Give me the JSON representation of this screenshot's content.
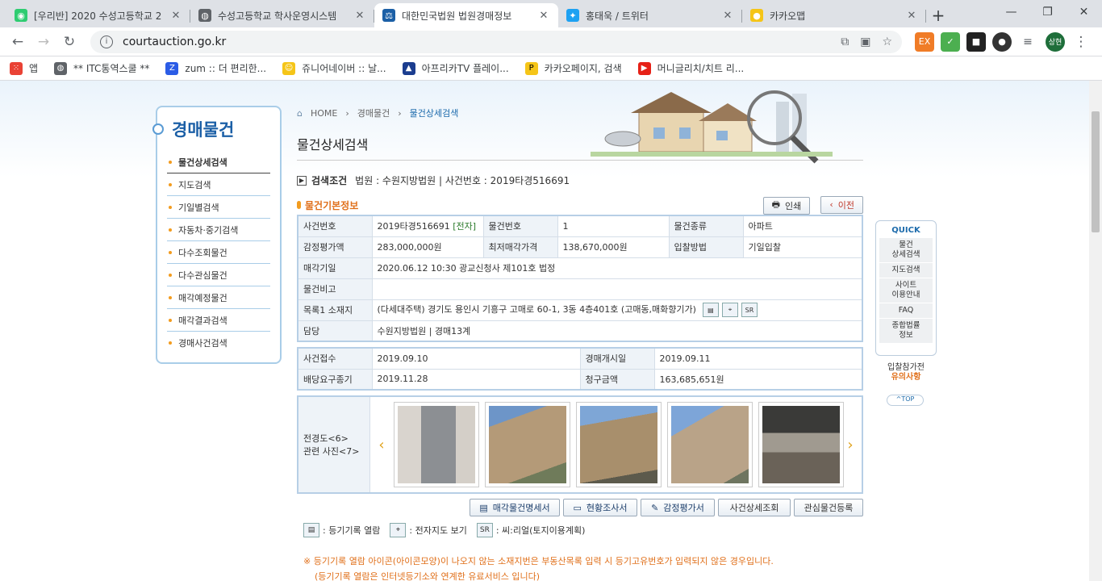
{
  "browser": {
    "tabs": [
      {
        "title": "[우리반] 2020 수성고등학교 2",
        "color": "#2ecc71"
      },
      {
        "title": "수성고등학교 학사운영시스템",
        "color": "#5f6368"
      },
      {
        "title": "대한민국법원 법원경매정보",
        "color": "#1b5fa6"
      },
      {
        "title": "홍태욱 / 트위터",
        "color": "#1da1f2"
      },
      {
        "title": "카카오맵",
        "color": "#f5c518"
      }
    ],
    "url": "courtauction.go.kr",
    "avatar": "상현",
    "bookmarks": [
      {
        "label": "앱",
        "color": "#e94235"
      },
      {
        "label": "** ITC통역스쿨 **",
        "color": "#5f6368"
      },
      {
        "label": "zum :: 더 편리한...",
        "color": "#2b5ce6"
      },
      {
        "label": "쥬니어네이버 :: 날...",
        "color": "#f5c518"
      },
      {
        "label": "아프리카TV 플레이...",
        "color": "#1b3d8f"
      },
      {
        "label": "카카오페이지, 검색",
        "color": "#f5c518"
      },
      {
        "label": "머니글리치/치트 리...",
        "color": "#e62117"
      }
    ]
  },
  "left_nav": {
    "title": "경매물건",
    "items": [
      "물건상세검색",
      "지도검색",
      "기일별검색",
      "자동차·중기검색",
      "다수조회물건",
      "다수관심물건",
      "매각예정물건",
      "매각결과검색",
      "경매사건검색"
    ]
  },
  "breadcrumb": {
    "home": "HOME",
    "level1": "경매물건",
    "level2": "물건상세검색"
  },
  "page_title": "물건상세검색",
  "search_condition": {
    "label": "검색조건",
    "value": "법원 : 수원지방법원 | 사건번호 : 2019타경516691"
  },
  "section_title": "물건기본정보",
  "buttons": {
    "print": "인쇄",
    "prev": "이전"
  },
  "basic_info": {
    "case_no_label": "사건번호",
    "case_no": "2019타경516691",
    "case_tag": "[전자]",
    "item_no_label": "물건번호",
    "item_no": "1",
    "item_type_label": "물건종류",
    "item_type": "아파트",
    "appraisal_label": "감정평가액",
    "appraisal": "283,000,000원",
    "min_price_label": "최저매각가격",
    "min_price": "138,670,000원",
    "bid_method_label": "입찰방법",
    "bid_method": "기일입찰",
    "sale_date_label": "매각기일",
    "sale_date": "2020.06.12 10:30 광교신청사 제101호 법정",
    "remarks_label": "물건비고",
    "remarks": "",
    "address_label": "목록1 소재지",
    "address": "(다세대주택) 경기도 용인시 기흥구 고매로 60-1, 3동 4층401호 (고매동,매화향기가)",
    "dept_label": "담당",
    "dept": "수원지방법원 | 경매13계"
  },
  "case_info": {
    "received_label": "사건접수",
    "received": "2019.09.10",
    "start_label": "경매개시일",
    "start": "2019.09.11",
    "dividend_label": "배당요구종기",
    "dividend": "2019.11.28",
    "claim_label": "청구금액",
    "claim": "163,685,651원"
  },
  "photos": {
    "label_line1": "전경도<6>",
    "label_line2": "관련 사진<7>"
  },
  "doc_buttons": [
    "매각물건명세서",
    "현황조사서",
    "감정평가서",
    "사건상세조회",
    "관심물건등록"
  ],
  "legend": [
    {
      "icon": "registry-icon",
      "text": ": 등기기록 열람"
    },
    {
      "icon": "map-icon",
      "text": ": 전자지도 보기"
    },
    {
      "icon": "seereal-icon",
      "text": ": 씨:리얼(토지이용계획)"
    }
  ],
  "notes": [
    "※ 등기기록 열람 아이콘(아이콘모양)이 나오지 않는 소재지번은 부동산목록 입력 시 등기고유번호가 입력되지 않은 경우입니다.",
    "(등기기록 열람은 인터넷등기소와 연계한 유료서비스 입니다)"
  ],
  "quick": {
    "title": "QUICK",
    "items": [
      "물건\n상세검색",
      "지도검색",
      "사이트\n이용안내",
      "FAQ",
      "종합법률\n정보"
    ],
    "notice_line1": "입찰참가전",
    "notice_line2": "유의사항",
    "top": "TOP"
  }
}
